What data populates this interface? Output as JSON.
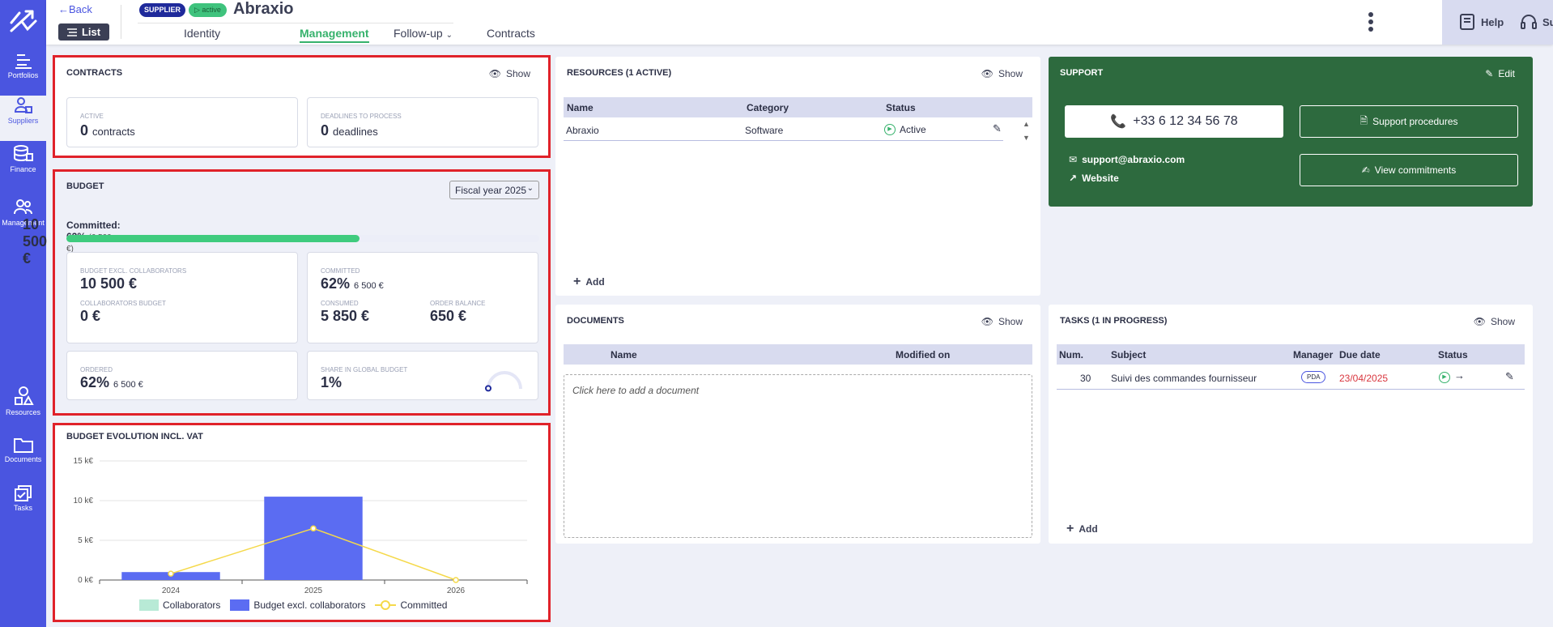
{
  "rail": {
    "items": [
      {
        "label": "Portfolios"
      },
      {
        "label": "Suppliers"
      },
      {
        "label": "Finance"
      },
      {
        "label": "Management"
      },
      {
        "label": "Resources"
      },
      {
        "label": "Documents"
      },
      {
        "label": "Tasks"
      }
    ],
    "active": "Suppliers"
  },
  "header": {
    "back_label": "Back",
    "list_label": "List",
    "badge_type": "SUPPLIER",
    "badge_status": "active",
    "title": "Abraxio",
    "tabs": [
      {
        "label": "Identity"
      },
      {
        "label": "Management",
        "active": true
      },
      {
        "label": "Follow-up"
      },
      {
        "label": "Contracts"
      }
    ],
    "help_label": "Help",
    "support_label": "Support"
  },
  "contracts": {
    "title": "CONTRACTS",
    "show_label": "Show",
    "active_label": "ACTIVE",
    "active_count": "0",
    "active_unit": "contracts",
    "deadlines_label": "DEADLINES TO PROCESS",
    "deadlines_count": "0",
    "deadlines_unit": "deadlines"
  },
  "budget": {
    "title": "BUDGET",
    "fiscal_year": "Fiscal year 2025",
    "committed_label": "Committed: 62%",
    "committed_amount": "(6 500 €)",
    "total": "10 500 €",
    "progress_percent": 62,
    "excl_label": "BUDGET EXCL. COLLABORATORS",
    "excl_value": "10 500 €",
    "collab_label": "COLLABORATORS BUDGET",
    "collab_value": "0 €",
    "committed_box_label": "COMMITTED",
    "committed_box_pct": "62%",
    "committed_box_amount": "6 500 €",
    "consumed_label": "CONSUMED",
    "consumed_value": "5 850 €",
    "balance_label": "ORDER BALANCE",
    "balance_value": "650 €",
    "ordered_label": "ORDERED",
    "ordered_pct": "62%",
    "ordered_amount": "6 500 €",
    "share_label": "SHARE IN GLOBAL BUDGET",
    "share_value": "1%",
    "share_fraction": 0.01
  },
  "evolution": {
    "title": "BUDGET EVOLUTION INCL. VAT",
    "legend": [
      "Collaborators",
      "Budget excl. collaborators",
      "Committed"
    ]
  },
  "chart_data": {
    "type": "bar",
    "categories": [
      "2024",
      "2025",
      "2026"
    ],
    "series": [
      {
        "name": "Collaborators",
        "values": [
          0,
          0,
          0
        ],
        "color": "#b8ead6"
      },
      {
        "name": "Budget excl. collaborators",
        "values": [
          1000,
          10500,
          0
        ],
        "color": "#5b6cf2"
      },
      {
        "name": "Committed",
        "values": [
          800,
          6500,
          0
        ],
        "color": "#f5d94a",
        "kind": "line"
      }
    ],
    "y_ticks": [
      "0 k€",
      "5 k€",
      "10 k€",
      "15 k€"
    ],
    "ylim": [
      0,
      15000
    ],
    "grid": true,
    "legend_position": "bottom"
  },
  "resources": {
    "title": "RESOURCES (1 ACTIVE)",
    "show_label": "Show",
    "columns": [
      "Name",
      "Category",
      "Status"
    ],
    "rows": [
      {
        "name": "Abraxio",
        "category": "Software",
        "status": "Active"
      }
    ],
    "add_label": "Add"
  },
  "documents": {
    "title": "DOCUMENTS",
    "show_label": "Show",
    "columns": [
      "Name",
      "Modified on"
    ],
    "drop_hint": "Click here to add a document"
  },
  "support": {
    "title": "SUPPORT",
    "edit_label": "Edit",
    "phone": "+33 6 12 34 56 78",
    "procedures_label": "Support procedures",
    "email": "support@abraxio.com",
    "website_label": "Website",
    "commitments_label": "View commitments",
    "color": "#2d6a3e"
  },
  "tasks": {
    "title": "TASKS (1 IN PROGRESS)",
    "show_label": "Show",
    "columns": [
      "Num.",
      "Subject",
      "Manager",
      "Due date",
      "Status"
    ],
    "rows": [
      {
        "num": "30",
        "subject": "Suivi des commandes fournisseur",
        "manager": "PDA",
        "due": "23/04/2025"
      }
    ],
    "add_label": "Add"
  }
}
